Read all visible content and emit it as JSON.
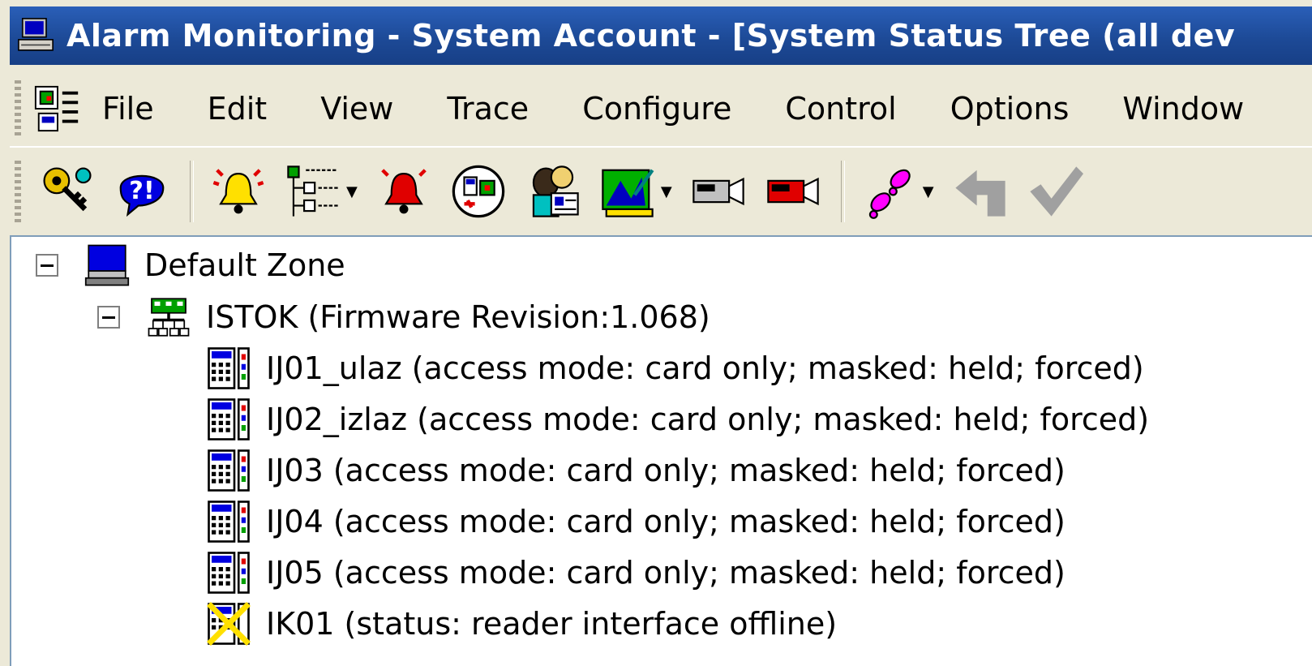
{
  "window": {
    "title": "Alarm Monitoring - System Account - [System Status Tree (all dev"
  },
  "menubar": {
    "items": [
      {
        "label": "File"
      },
      {
        "label": "Edit"
      },
      {
        "label": "View"
      },
      {
        "label": "Trace"
      },
      {
        "label": "Configure"
      },
      {
        "label": "Control"
      },
      {
        "label": "Options"
      },
      {
        "label": "Window"
      }
    ]
  },
  "toolbar": {
    "buttons": [
      {
        "icon": "keys-icon"
      },
      {
        "icon": "help-icon"
      },
      {
        "icon": "alarm-bell-yellow-icon"
      },
      {
        "icon": "tree-view-icon",
        "dropdown": true
      },
      {
        "icon": "alarm-bell-red-icon"
      },
      {
        "icon": "device-status-icon"
      },
      {
        "icon": "badge-people-icon"
      },
      {
        "icon": "map-icon",
        "dropdown": true
      },
      {
        "icon": "camera-icon"
      },
      {
        "icon": "camera-red-icon"
      },
      {
        "icon": "footsteps-icon",
        "dropdown": true
      },
      {
        "icon": "arrow-disabled-icon"
      },
      {
        "icon": "check-disabled-icon"
      }
    ],
    "colors": {
      "accent": "#0000cc",
      "alert": "#e00000",
      "magenta": "#ff00ff"
    }
  },
  "tree": {
    "zone": {
      "label": "Default Zone"
    },
    "controller": {
      "label": "ISTOK (Firmware Revision:1.068)"
    },
    "readers": [
      {
        "label": "IJ01_ulaz (access mode: card only; masked: held; forced)",
        "status": "ok"
      },
      {
        "label": "IJ02_izlaz (access mode: card only; masked: held; forced)",
        "status": "ok"
      },
      {
        "label": "IJ03 (access mode: card only; masked: held; forced)",
        "status": "ok"
      },
      {
        "label": "IJ04 (access mode: card only; masked: held; forced)",
        "status": "ok"
      },
      {
        "label": "IJ05 (access mode: card only; masked: held; forced)",
        "status": "ok"
      },
      {
        "label": "IK01 (status: reader interface offline)",
        "status": "offline"
      }
    ]
  }
}
